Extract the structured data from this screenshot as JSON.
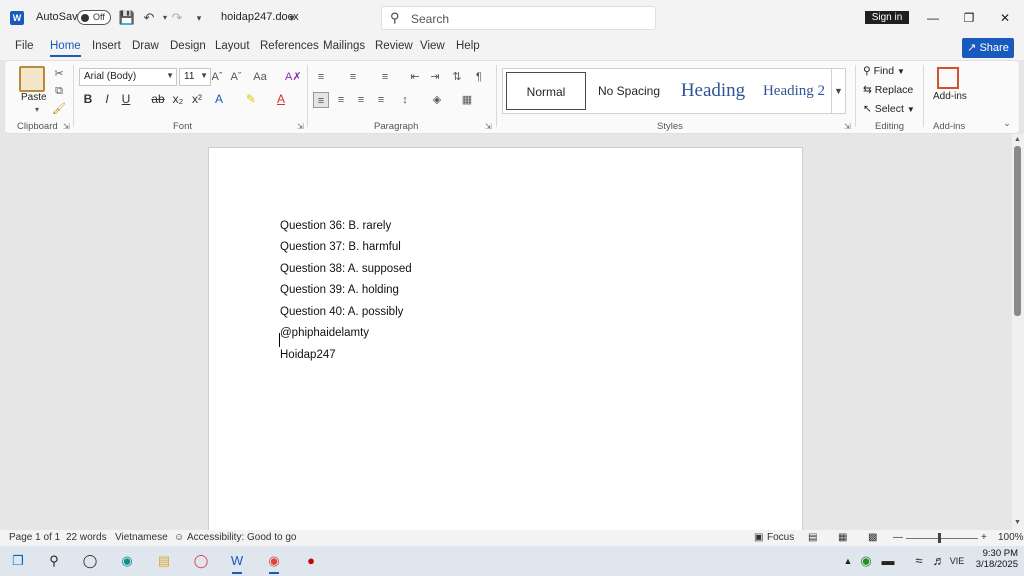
{
  "titlebar": {
    "autosave_label": "AutoSave",
    "autosave_state": "Off",
    "document_name": "hoidap247.docx",
    "search_placeholder": "Search",
    "signin_label": "Sign in"
  },
  "menu": {
    "tabs": [
      "File",
      "Home",
      "Insert",
      "Draw",
      "Design",
      "Layout",
      "References",
      "Mailings",
      "Review",
      "View",
      "Help"
    ],
    "active_tab": "Home",
    "share_label": "Share"
  },
  "ribbon": {
    "clipboard": {
      "paste_label": "Paste",
      "group_label": "Clipboard"
    },
    "font": {
      "font_name": "Arial (Body)",
      "font_size": "11",
      "group_label": "Font"
    },
    "paragraph": {
      "group_label": "Paragraph"
    },
    "styles": {
      "items": [
        "Normal",
        "No Spacing",
        "Heading",
        "Heading 2"
      ],
      "group_label": "Styles"
    },
    "editing": {
      "find_label": "Find",
      "replace_label": "Replace",
      "select_label": "Select",
      "group_label": "Editing"
    },
    "addins": {
      "label": "Add-ins",
      "group_label": "Add-ins"
    }
  },
  "document": {
    "lines": [
      "Question 36: B. rarely",
      "Question 37: B. harmful",
      "Question 38: A. supposed",
      "Question 39: A. holding",
      "Question 40: A. possibly",
      "@phiphaidelamty",
      "Hoidap247"
    ]
  },
  "status": {
    "page": "Page 1 of 1",
    "words": "22 words",
    "language": "Vietnamese",
    "accessibility": "Accessibility: Good to go",
    "focus": "Focus",
    "zoom": "100%"
  },
  "taskbar": {
    "lang": "VIE",
    "time": "9:30 PM",
    "date": "3/18/2025"
  },
  "colors": {
    "accent": "#185abd",
    "heading": "#2f5496"
  }
}
